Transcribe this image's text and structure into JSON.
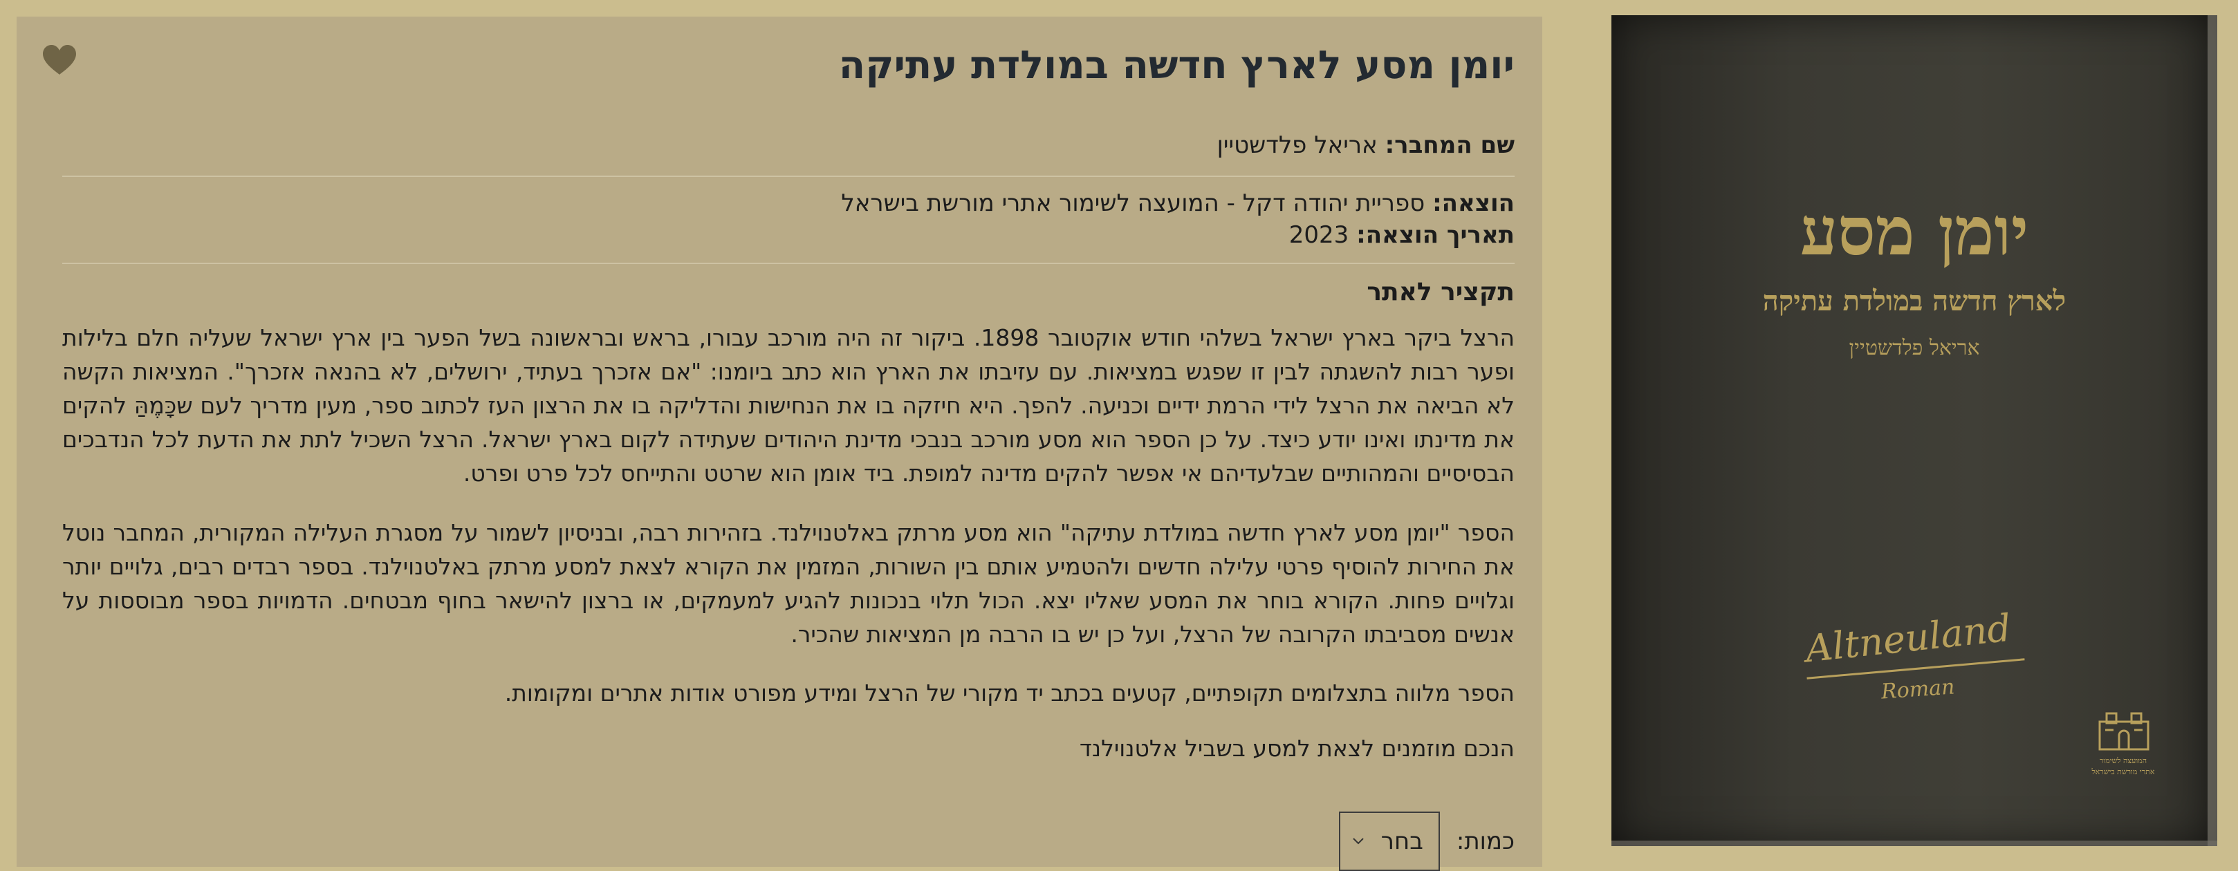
{
  "product": {
    "title": "יומן מסע לארץ חדשה במולדת עתיקה",
    "author_label": "שם המחבר:",
    "author": "אריאל פלדשטיין",
    "publisher_label": "הוצאה:",
    "publisher": "ספריית יהודה דקל - המועצה לשימור אתרי מורשת בישראל",
    "date_label": "תאריך הוצאה:",
    "date": "2023",
    "summary_heading": "תקציר לאתר",
    "paragraphs": [
      "הרצל ביקר בארץ ישראל בשלהי חודש אוקטובר 1898. ביקור זה היה מורכב עבורו, בראש ובראשונה בשל הפער בין ארץ ישראל שעליה חלם בלילות ופער רבות להשגתה לבין זו שפגש במציאות. עם עזיבתו את הארץ הוא כתב ביומנו: \"אם אזכרך בעתיד, ירושלים, לא בהנאה אזכרך\". המציאות הקשה לא הביאה את הרצל לידי הרמת ידיים וכניעה. להפך. היא חיזקה בו את הנחישות והדליקה בו את הרצון העז לכתוב ספר, מעין מדריך לעם שכָּמֶהַּ להקים את מדינתו ואינו יודע כיצד. על כן הספר הוא מסע מורכב בנבכי מדינת היהודים שעתידה לקום בארץ ישראל. הרצל השכיל לתת את הדעת לכל הנדבכים הבסיסיים והמהותיים שבלעדיהם אי אפשר להקים מדינה למופת. ביד אומן הוא שרטט והתייחס לכל פרט ופרט.",
      "הספר \"יומן מסע לארץ חדשה במולדת עתיקה\" הוא מסע מרתק באלטנוילנד. בזהירות רבה, ובניסיון לשמור על מסגרת העלילה המקורית, המחבר נוטל את החירות להוסיף פרטי עלילה חדשים ולהטמיע אותם בין השורות, המזמין את הקורא לצאת למסע מרתק באלטנוילנד.  בספר רבדים רבים, גלויים יותר וגלויים פחות. הקורא בוחר את המסע שאליו יצא. הכול תלוי בנכונות להגיע למעמקים, או ברצון להישאר בחוף מבטחים. הדמויות בספר מבוססות על אנשים מסביבתו הקרובה של הרצל, ועל כן יש בו הרבה מן המציאות שהכיר.",
      "הספר מלווה בתצלומים תקופתיים, קטעים בכתב יד מקורי של הרצל ומידע מפורט אודות אתרים ומקומות.",
      "הנכם מוזמנים לצאת למסע בשביל אלטנוילנד"
    ],
    "quantity_label": "כמות:",
    "quantity_value": "בחר"
  },
  "cover": {
    "title": "יומן מסע",
    "subtitle": "לארץ חדשה במולדת עתיקה",
    "author": "אריאל פלדשטיין",
    "signature": "Altneuland",
    "signature_sub": "Roman",
    "publisher_logo_line1": "המועצה לשימור",
    "publisher_logo_line2": "אתרי מורשת בישראל"
  },
  "icons": {
    "favorite": "heart-icon",
    "select": "chevron-down-icon"
  },
  "colors": {
    "page_bg": "#cbbd8e",
    "panel_bg": "#b9ab87",
    "title": "#232a31",
    "cover_bg": "#3b3a33",
    "cover_text": "#b8a05c"
  }
}
